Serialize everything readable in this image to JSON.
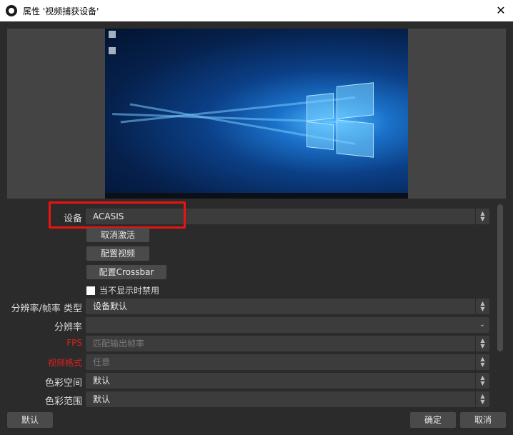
{
  "window": {
    "title": "属性 '视频捕获设备'",
    "close_glyph": "✕"
  },
  "preview": {
    "description_icon": "windows-desktop-preview"
  },
  "form": {
    "device_label": "设备",
    "device_value": "ACASIS",
    "deactivate_button": "取消激活",
    "configure_video_button": "配置视频",
    "configure_crossbar_button": "配置Crossbar",
    "deactivate_when_hidden_label": "当不显示时禁用",
    "deactivate_when_hidden_checked": false,
    "resolution_fps_type_label": "分辨率/帧率 类型",
    "resolution_fps_type_value": "设备默认",
    "resolution_label": "分辨率",
    "resolution_value": "",
    "fps_label": "FPS",
    "fps_value": "匹配输出帧率",
    "video_format_label": "视频格式",
    "video_format_value": "任意",
    "color_space_label": "色彩空间",
    "color_space_value": "默认",
    "color_range_label": "色彩范围",
    "color_range_value": "默认"
  },
  "footer": {
    "defaults_button": "默认",
    "ok_button": "确定",
    "cancel_button": "取消"
  },
  "colors": {
    "background": "#2b2b2b",
    "field": "#3c3c3c",
    "highlight": "#ee1111",
    "required_label": "#e02020"
  }
}
